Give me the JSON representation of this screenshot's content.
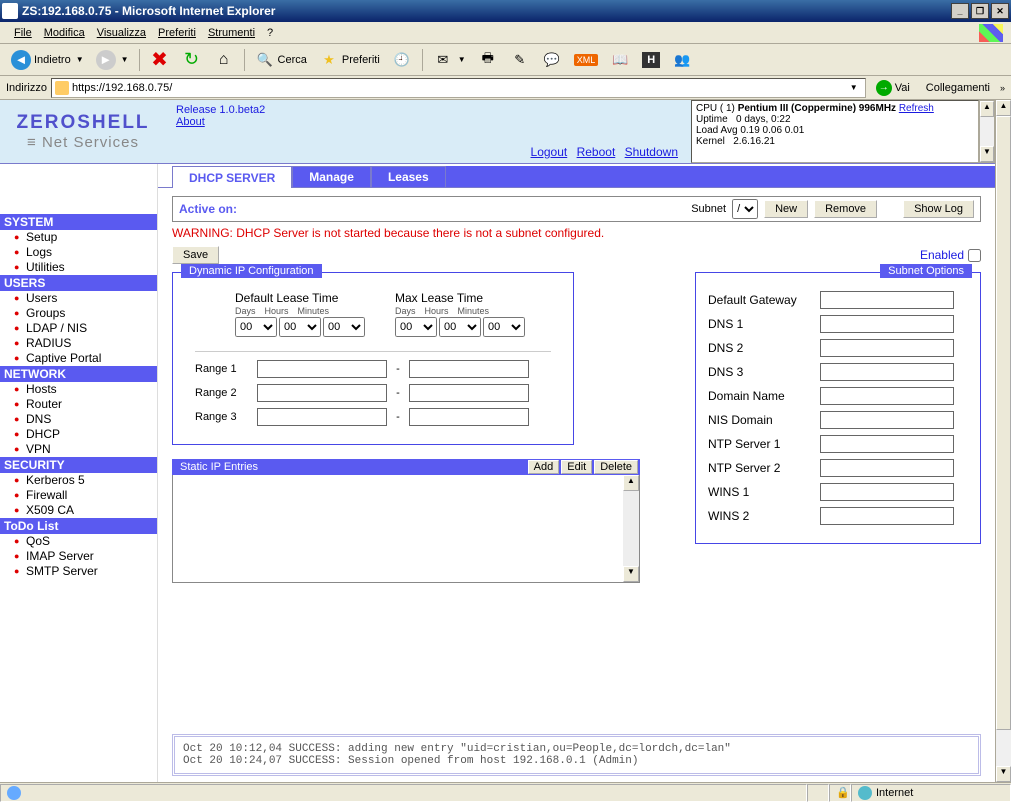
{
  "window": {
    "title": "ZS:192.168.0.75 - Microsoft Internet Explorer"
  },
  "menubar": [
    "File",
    "Modifica",
    "Visualizza",
    "Preferiti",
    "Strumenti",
    "?"
  ],
  "toolbar": {
    "back": "Indietro",
    "search": "Cerca",
    "favorites": "Preferiti"
  },
  "addressbar": {
    "label": "Indirizzo",
    "url": "https://192.168.0.75/",
    "go": "Vai",
    "links": "Collegamenti"
  },
  "logo": {
    "main": "ZEROSHELL",
    "sub": "Net Services"
  },
  "header": {
    "release": "Release 1.0.beta2",
    "about": "About",
    "logout": "Logout",
    "reboot": "Reboot",
    "shutdown": "Shutdown"
  },
  "sysinfo": {
    "cpu_label": "CPU ( 1)",
    "cpu_value": "Pentium III (Coppermine) 996MHz",
    "refresh": "Refresh",
    "uptime_label": "Uptime",
    "uptime_value": "0 days, 0:22",
    "loadavg_label": "Load Avg",
    "loadavg_value": "0.19 0.06 0.01",
    "kernel_label": "Kernel",
    "kernel_value": "2.6.16.21"
  },
  "sidebar": {
    "sections": [
      {
        "title": "SYSTEM",
        "items": [
          "Setup",
          "Logs",
          "Utilities"
        ]
      },
      {
        "title": "USERS",
        "items": [
          "Users",
          "Groups",
          "LDAP / NIS",
          "RADIUS",
          "Captive Portal"
        ]
      },
      {
        "title": "NETWORK",
        "items": [
          "Hosts",
          "Router",
          "DNS",
          "DHCP",
          "VPN"
        ]
      },
      {
        "title": "SECURITY",
        "items": [
          "Kerberos 5",
          "Firewall",
          "X509 CA"
        ]
      },
      {
        "title": "ToDo List",
        "items": [
          "QoS",
          "IMAP Server",
          "SMTP Server"
        ]
      }
    ]
  },
  "tabs": {
    "active": "DHCP SERVER",
    "t1": "Manage",
    "t2": "Leases"
  },
  "activeon": {
    "label": "Active on:",
    "subnet_label": "Subnet",
    "subnet_value": "/",
    "new": "New",
    "remove": "Remove",
    "showlog": "Show Log"
  },
  "warning": "WARNING: DHCP Server is not started because there is not a subnet configured.",
  "save": "Save",
  "enabled": "Enabled",
  "dynamic": {
    "legend": "Dynamic IP Configuration",
    "default_lease": "Default Lease Time",
    "max_lease": "Max Lease Time",
    "days": "Days",
    "hours": "Hours",
    "minutes": "Minutes",
    "val": "00",
    "range1": "Range 1",
    "range2": "Range 2",
    "range3": "Range 3"
  },
  "subnet": {
    "legend": "Subnet Options",
    "fields": [
      "Default Gateway",
      "DNS 1",
      "DNS 2",
      "DNS 3",
      "Domain Name",
      "NIS Domain",
      "NTP Server 1",
      "NTP Server 2",
      "WINS 1",
      "WINS 2"
    ]
  },
  "static": {
    "legend": "Static IP Entries",
    "add": "Add",
    "edit": "Edit",
    "delete": "Delete"
  },
  "logs": [
    "Oct 20 10:12,04 SUCCESS: adding new entry \"uid=cristian,ou=People,dc=lordch,dc=lan\"",
    "Oct 20 10:24,07 SUCCESS: Session opened from host 192.168.0.1 (Admin)"
  ],
  "statusbar": {
    "zone": "Internet"
  }
}
